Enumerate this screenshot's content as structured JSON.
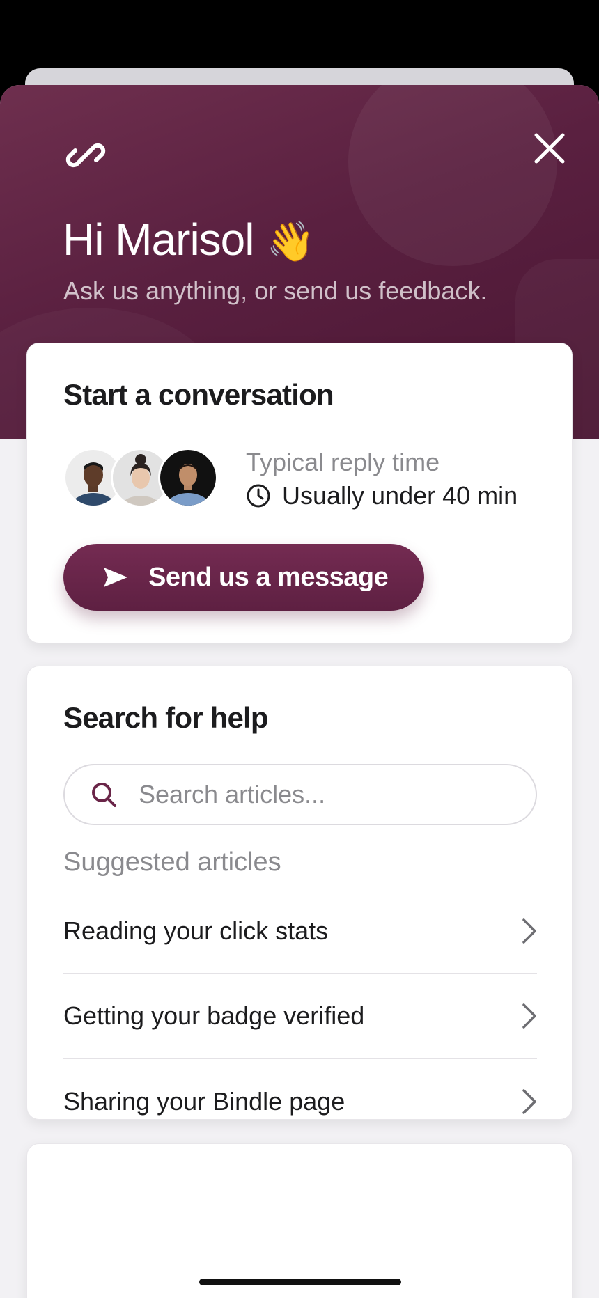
{
  "header": {
    "greeting": "Hi Marisol",
    "wave_emoji": "👋",
    "subtitle": "Ask us anything, or send us feedback.",
    "icons": {
      "logo": "link-icon",
      "close": "close-icon"
    }
  },
  "conversation": {
    "title": "Start a conversation",
    "reply_label": "Typical reply time",
    "reply_value": "Usually under 40 min",
    "button_label": "Send us a message",
    "accent_color": "#6a2548"
  },
  "help": {
    "title": "Search for help",
    "search_placeholder": "Search articles...",
    "suggested_label": "Suggested articles",
    "articles": [
      {
        "label": "Reading your click stats"
      },
      {
        "label": "Getting your badge verified"
      },
      {
        "label": "Sharing your Bindle page"
      }
    ]
  }
}
